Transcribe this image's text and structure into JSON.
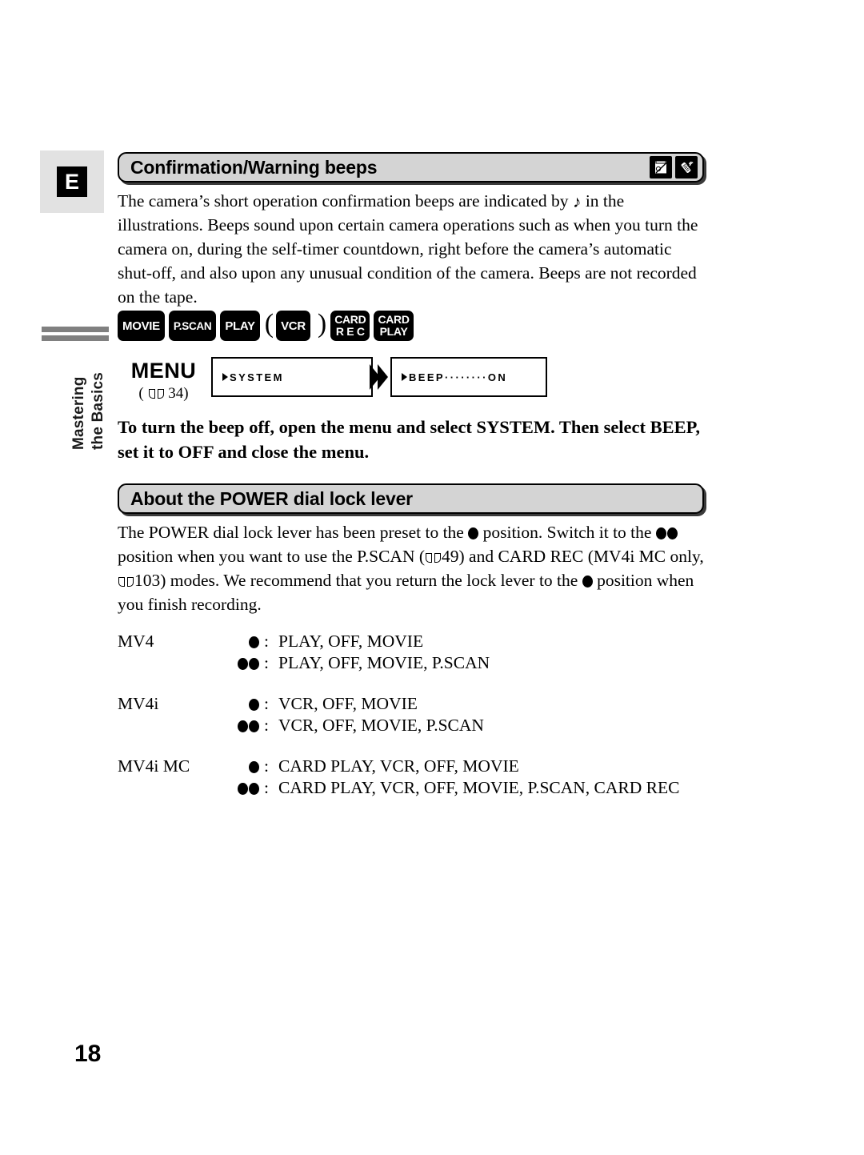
{
  "page": {
    "number": "18",
    "language_badge": "E",
    "side_tab": {
      "line1": "Mastering",
      "line2": "the Basics"
    }
  },
  "sections": [
    {
      "id": "confirmation-warning-beeps",
      "title": "Confirmation/Warning beeps",
      "icons": [
        "tape-crossed-icon",
        "remote-control-icon"
      ],
      "body_intro": "The camera’s short operation confirmation beeps are indicated by",
      "body_rest": "in the illustrations. Beeps sound upon certain camera operations such as when you turn the camera on, during the self-timer countdown, right before the camera’s automatic shut-off, and also upon any unusual condition of the camera. Beeps are not recorded on the tape."
    },
    {
      "id": "about-power-dial-lock-lever",
      "title": "About the POWER dial lock lever",
      "body_part1": "The POWER dial lock lever has been preset to the",
      "body_part2": "position. Switch it to the",
      "body_part3": "position when you want to use the P.SCAN (",
      "ref_pscan": "49",
      "body_part4": ") and CARD REC (MV4i MC only,",
      "ref_cardrec": "103",
      "body_part5": ") modes. We recommend that you return the lock lever to the",
      "body_part6": "position when you finish recording."
    }
  ],
  "mode_badges": [
    {
      "label": "MOVIE",
      "style": "one-line",
      "paren_before": false,
      "paren_after": false
    },
    {
      "label": "P.SCAN",
      "style": "one-line",
      "paren_before": false,
      "paren_after": false
    },
    {
      "label": "PLAY",
      "style": "one-line",
      "paren_before": false,
      "paren_after": false
    },
    {
      "label": "VCR",
      "style": "one-line",
      "paren_before": true,
      "paren_after": true
    },
    {
      "label_line1": "CARD",
      "label_line2": "R E C",
      "style": "two-line",
      "paren_before": false,
      "paren_after": false
    },
    {
      "label_line1": "CARD",
      "label_line2": "PLAY",
      "style": "two-line",
      "paren_before": false,
      "paren_after": false
    }
  ],
  "paren_open": "(",
  "paren_close": ")",
  "menu_flow": {
    "menu_word": "MENU",
    "menu_ref_open": "(",
    "menu_ref_page": "34",
    "menu_ref_close": ")",
    "screen1": "SYSTEM",
    "screen2": "BEEP········ON"
  },
  "instruction": "To turn the beep off, open the menu and select SYSTEM. Then select BEEP, set it to OFF and close the menu.",
  "model_table": [
    {
      "name": "MV4",
      "rows": [
        {
          "dots": 1,
          "colon": ":",
          "modes": "PLAY, OFF, MOVIE"
        },
        {
          "dots": 2,
          "colon": ":",
          "modes": "PLAY, OFF, MOVIE, P.SCAN"
        }
      ]
    },
    {
      "name": "MV4i",
      "rows": [
        {
          "dots": 1,
          "colon": ":",
          "modes": "VCR, OFF, MOVIE"
        },
        {
          "dots": 2,
          "colon": ":",
          "modes": "VCR, OFF, MOVIE, P.SCAN"
        }
      ]
    },
    {
      "name": "MV4i MC",
      "rows": [
        {
          "dots": 1,
          "colon": ":",
          "modes": "CARD PLAY, VCR, OFF, MOVIE"
        },
        {
          "dots": 2,
          "colon": ":",
          "modes": "CARD PLAY, VCR, OFF, MOVIE, P.SCAN, CARD REC"
        }
      ]
    }
  ],
  "colors": {
    "bar_fill": "#d4d4d4",
    "panel_gray": "#e2e2e2",
    "rule_gray": "#808080"
  }
}
